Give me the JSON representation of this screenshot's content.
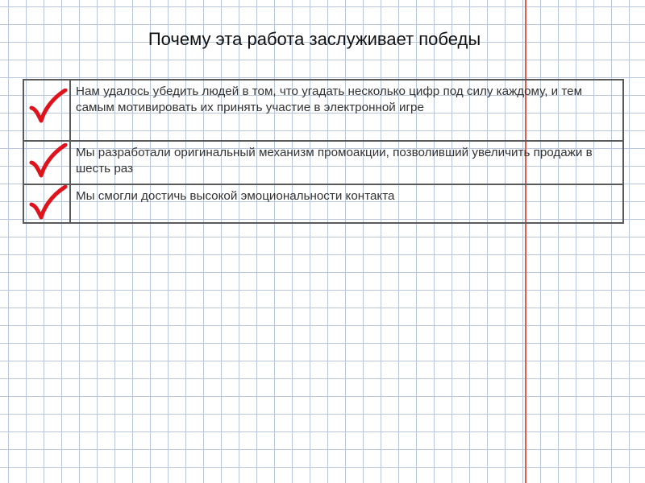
{
  "title": "Почему эта работа заслуживает победы",
  "reasons": [
    {
      "icon": "red-checkmark-icon",
      "text": "Нам удалось убедить людей в том, что угадать несколько цифр под силу каждому, и тем самым мотивировать их принять участие в электронной игре"
    },
    {
      "icon": "red-checkmark-icon",
      "text": "Мы разработали оригинальный механизм промоакции, позволивший увеличить продажи в шесть раз"
    },
    {
      "icon": "red-checkmark-icon",
      "text": "Мы смогли достичь высокой эмоциональности контакта"
    }
  ],
  "colors": {
    "check": "#e0121b",
    "grid": "#b9c7dc",
    "margin_line": "#e05a50",
    "table_border": "#5a5a5a"
  }
}
